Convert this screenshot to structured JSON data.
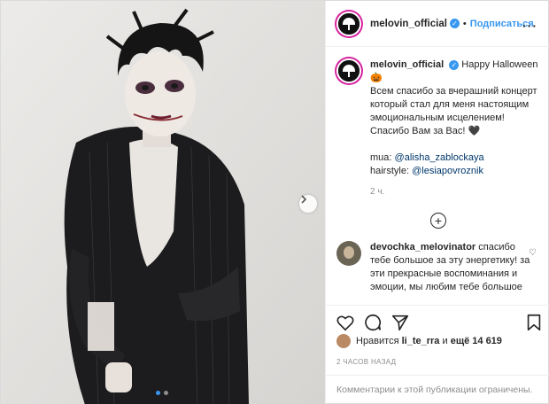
{
  "post": {
    "username": "melovin_official",
    "follow_label": "Подписаться",
    "separator": "•",
    "more_label": "···"
  },
  "caption": {
    "username": "melovin_official",
    "heading": "Happy Halloween",
    "emoji_pumpkin": "🎃",
    "body_line1": "Всем спасибо за вчерашний концерт который стал для меня настоящим эмоциональным исцелением!",
    "body_line2": "Спасибо Вам за Вас! 🖤",
    "mua_label": "mua:",
    "mua_handle": "@alisha_zablockaya",
    "hair_label": "hairstyle:",
    "hair_handle": "@lesiapovroznik",
    "time": "2 ч."
  },
  "comment": {
    "username": "devochka_melovinator",
    "text": "спасибо тебе большое за эту энергетику! за эти прекрасные воспоминания и эмоции, мы любим тебе большое"
  },
  "likes": {
    "prefix": "Нравится",
    "user": "li_te_rra",
    "mid": "и",
    "count": "ещё 14 619"
  },
  "date": "2 часов назад",
  "comments_disabled": "Комментарии к этой публикации ограничены.",
  "colors": {
    "accent": "#3897f0",
    "text": "#262626",
    "muted": "#8e8e8e",
    "border": "#efefef"
  },
  "icons": [
    "verified-icon",
    "heart-icon",
    "comment-icon",
    "share-icon",
    "save-icon",
    "plus-circle-icon",
    "chevron-right-icon"
  ]
}
